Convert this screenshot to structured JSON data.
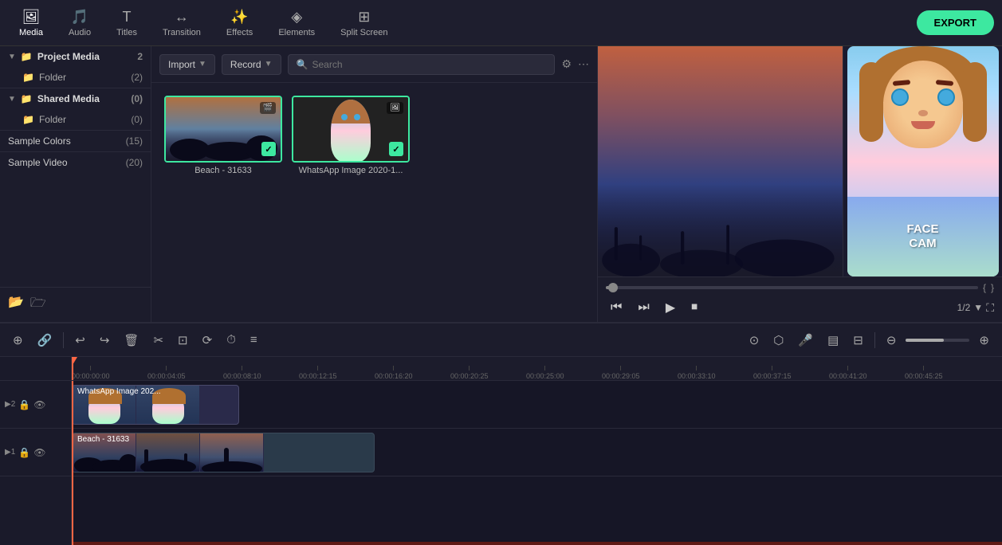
{
  "toolbar": {
    "export_label": "EXPORT",
    "items": [
      {
        "id": "media",
        "label": "Media",
        "icon": "🖼"
      },
      {
        "id": "audio",
        "label": "Audio",
        "icon": "🎵"
      },
      {
        "id": "titles",
        "label": "Titles",
        "icon": "T"
      },
      {
        "id": "transition",
        "label": "Transition",
        "icon": "↔"
      },
      {
        "id": "effects",
        "label": "Effects",
        "icon": "✨"
      },
      {
        "id": "elements",
        "label": "Elements",
        "icon": "◈"
      },
      {
        "id": "splitscreen",
        "label": "Split Screen",
        "icon": "⊞"
      }
    ]
  },
  "sidebar": {
    "sections": [
      {
        "id": "project-media",
        "label": "Project Media",
        "count": "2",
        "expanded": true,
        "children": [
          {
            "id": "folder-1",
            "label": "Folder",
            "count": "2"
          }
        ]
      },
      {
        "id": "shared-media",
        "label": "Shared Media",
        "count": "0",
        "expanded": true,
        "children": [
          {
            "id": "folder-2",
            "label": "Folder",
            "count": "0"
          }
        ]
      },
      {
        "id": "sample-colors",
        "label": "Sample Colors",
        "count": "15"
      },
      {
        "id": "sample-video",
        "label": "Sample Video",
        "count": "20"
      }
    ],
    "bottom_buttons": [
      "new-folder-icon",
      "folder-icon"
    ]
  },
  "media_panel": {
    "import_label": "Import",
    "record_label": "Record",
    "search_placeholder": "Search",
    "items": [
      {
        "id": "beach",
        "label": "Beach - 31633",
        "type": "video",
        "selected": true
      },
      {
        "id": "whatsapp",
        "label": "WhatsApp Image 2020-1...",
        "type": "image",
        "selected": true
      }
    ]
  },
  "playback": {
    "page": "1/2",
    "progress_percent": 2
  },
  "edit_toolbar": {
    "buttons": [
      {
        "id": "undo",
        "icon": "↩",
        "label": "Undo"
      },
      {
        "id": "redo",
        "icon": "↪",
        "label": "Redo"
      },
      {
        "id": "delete",
        "icon": "🗑",
        "label": "Delete"
      },
      {
        "id": "cut",
        "icon": "✂",
        "label": "Cut"
      },
      {
        "id": "crop",
        "icon": "⊡",
        "label": "Crop"
      },
      {
        "id": "rotate",
        "icon": "⟳",
        "label": "Rotate"
      },
      {
        "id": "freeze",
        "icon": "⏱",
        "label": "Freeze"
      },
      {
        "id": "adjust",
        "icon": "≡",
        "label": "Adjust"
      }
    ],
    "right_buttons": [
      {
        "id": "motion",
        "icon": "⊙",
        "label": "Motion"
      },
      {
        "id": "mask",
        "icon": "⬡",
        "label": "Mask"
      },
      {
        "id": "voice",
        "icon": "🎤",
        "label": "Voice"
      },
      {
        "id": "captions",
        "icon": "▤",
        "label": "Captions"
      },
      {
        "id": "split",
        "icon": "⊟",
        "label": "Split"
      },
      {
        "id": "zoom-out",
        "icon": "⊖",
        "label": "Zoom Out"
      },
      {
        "id": "zoom-in",
        "icon": "⊕",
        "label": "Zoom In"
      }
    ]
  },
  "timeline": {
    "tracks": [
      {
        "id": "track-video-2",
        "type": "video",
        "track_num": 2,
        "clip_label": "WhatsApp Image 202..."
      },
      {
        "id": "track-video-1",
        "type": "video",
        "track_num": 1,
        "clip_label": "Beach - 31633"
      }
    ],
    "ruler_marks": [
      "00:00:00:00",
      "00:00:04:05",
      "00:00:08:10",
      "00:00:12:15",
      "00:00:16:20",
      "00:00:20:25",
      "00:00:25:00",
      "00:00:29:05",
      "00:00:33:10",
      "00:00:37:15",
      "00:00:41:20",
      "00:00:45:25"
    ]
  }
}
